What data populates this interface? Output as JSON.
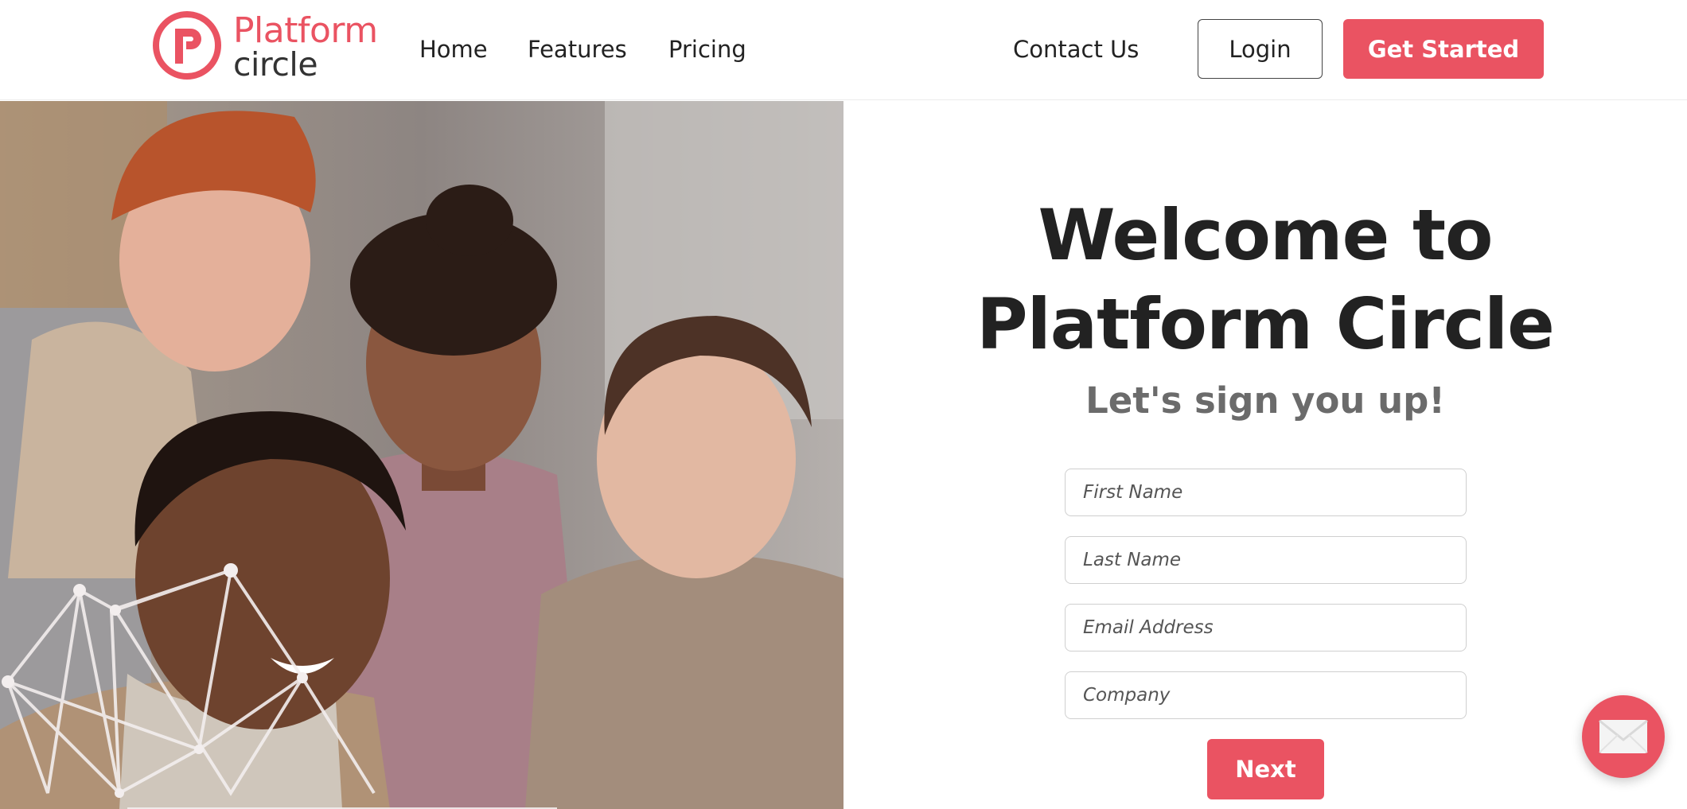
{
  "header": {
    "logo": {
      "word1": "Platform",
      "word2": "circle"
    },
    "nav": {
      "home": "Home",
      "features": "Features",
      "pricing": "Pricing",
      "contact": "Contact Us"
    },
    "login_label": "Login",
    "get_started_label": "Get Started"
  },
  "hero": {
    "image": "people-smiling-at-laptop-photo"
  },
  "signup": {
    "title": "Welcome to Platform Circle",
    "subtitle": "Let's sign you up!",
    "fields": {
      "first_name": {
        "placeholder": "First Name"
      },
      "last_name": {
        "placeholder": "Last Name"
      },
      "email": {
        "placeholder": "Email Address"
      },
      "company": {
        "placeholder": "Company"
      }
    },
    "next_label": "Next"
  },
  "chat": {
    "icon": "envelope-icon"
  },
  "colors": {
    "brand": "#ea5362",
    "text": "#222222",
    "subtitle": "#6b6b6b"
  }
}
